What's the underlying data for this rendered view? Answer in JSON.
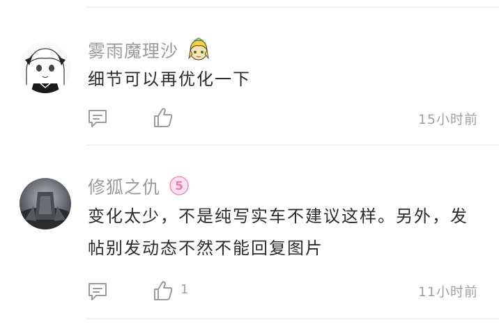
{
  "comments": [
    {
      "username": "雾雨魔理沙",
      "badge_icon": "anime-character-emoji-icon",
      "text": "细节可以再优化一下",
      "like_count": "",
      "time": "15小时前"
    },
    {
      "username": "修狐之仇",
      "badge_level": "5",
      "text": "变化太少，不是纯写实车不建议这样。另外，发帖别发动态不然不能回复图片",
      "like_count": "1",
      "time": "11小时前"
    }
  ],
  "colors": {
    "username": "#9a9a9a",
    "text": "#2b2b2b",
    "meta": "#a0a0a0",
    "divider": "#e9e9e9",
    "level_badge": "#f28dbd"
  }
}
